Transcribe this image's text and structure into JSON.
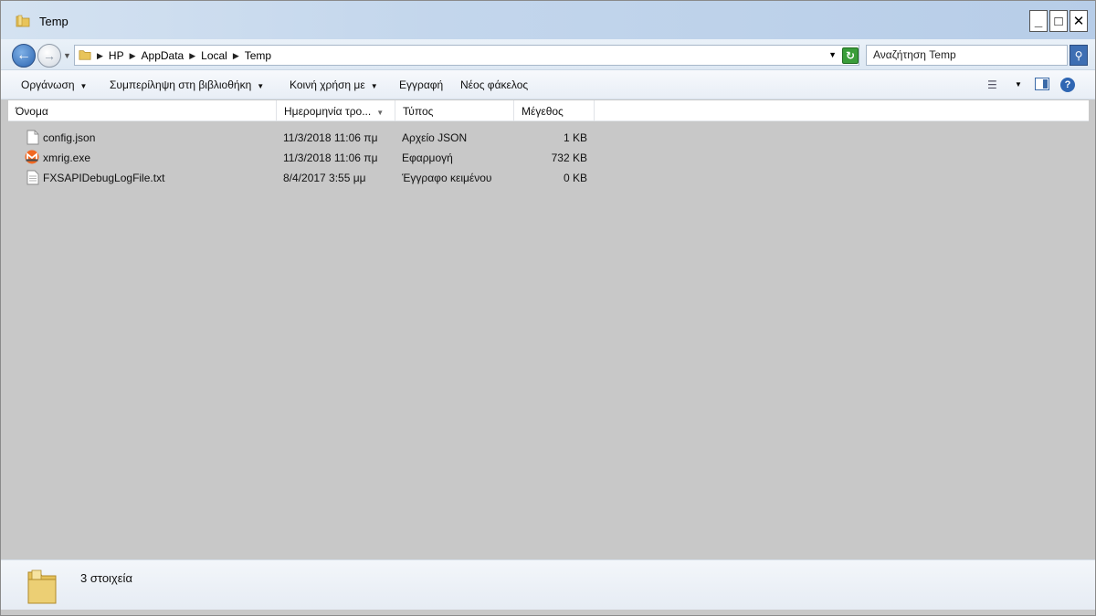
{
  "window": {
    "title": "Temp",
    "controls": {
      "minimize": "_",
      "maximize": "□",
      "close": "✕"
    }
  },
  "address": {
    "crumbs": [
      "HP",
      "AppData",
      "Local",
      "Temp"
    ],
    "search_placeholder": "Αναζήτηση Temp"
  },
  "toolbar": {
    "organize": "Οργάνωση",
    "include_library": "Συμπερίληψη στη βιβλιοθήκη",
    "share_with": "Κοινή χρήση με",
    "burn": "Εγγραφή",
    "new_folder": "Νέος φάκελος"
  },
  "columns": {
    "name": "Όνομα",
    "date": "Ημερομηνία τρο...",
    "type": "Τύπος",
    "size": "Μέγεθος"
  },
  "files": [
    {
      "name": "config.json",
      "date": "11/3/2018 11:06 πμ",
      "type": "Αρχείο JSON",
      "size": "1 KB",
      "icon": "file-icon"
    },
    {
      "name": "xmrig.exe",
      "date": "11/3/2018 11:06 πμ",
      "type": "Εφαρμογή",
      "size": "732 KB",
      "icon": "monero-icon"
    },
    {
      "name": "FXSAPIDebugLogFile.txt",
      "date": "8/4/2017 3:55 μμ",
      "type": "Έγγραφο κειμένου",
      "size": "0 KB",
      "icon": "text-file-icon"
    }
  ],
  "status": {
    "item_count": "3 στοιχεία"
  },
  "colors": {
    "titlebar": "#c3d6ec",
    "monero": "#f26822"
  }
}
